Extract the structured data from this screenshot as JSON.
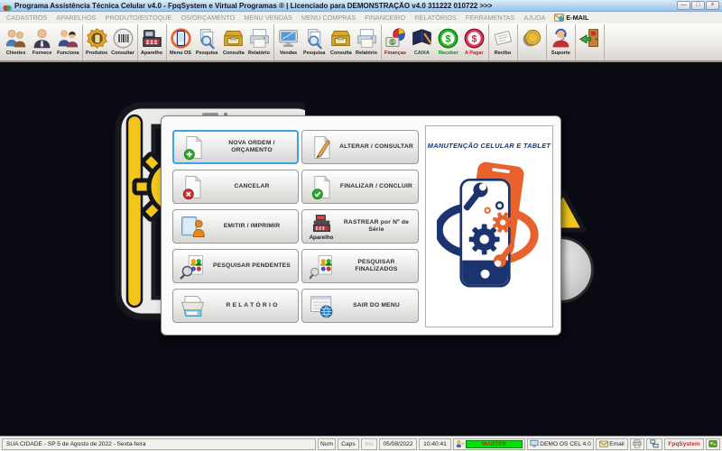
{
  "colors": {
    "accent_blue": "#3fa2e2",
    "brand_orange": "#e8622d",
    "brand_navy": "#1b3470",
    "master_green": "#00e106",
    "fpq_red": "#e02424"
  },
  "window": {
    "title": "Programa Assistência Técnica Celular v4.0 - FpqSystem e Virtual Programas ® | Licenciado para  DEMONSTRAÇÃO v4.0 311222 010722 >>>",
    "controls": {
      "minimize": "—",
      "maximize": "□",
      "close": "×"
    }
  },
  "menubar": {
    "items": [
      {
        "label": "CADASTROS"
      },
      {
        "label": "APARELHOS"
      },
      {
        "label": "PRODUTO/ESTOQUE"
      },
      {
        "label": "OS/ORÇAMENTO"
      },
      {
        "label": "MENU VENDAS"
      },
      {
        "label": "MENU COMPRAS"
      },
      {
        "label": "FINANCEIRO"
      },
      {
        "label": "RELATÓRIOS"
      },
      {
        "label": "FERRAMENTAS"
      },
      {
        "label": "AJUDA"
      },
      {
        "label": "E-MAIL",
        "icon": "email-icon"
      }
    ]
  },
  "toolbar": {
    "groups": [
      {
        "items": [
          {
            "label": "Clientes",
            "icon": "clients-icon"
          },
          {
            "label": "Fornece",
            "icon": "suppliers-icon"
          },
          {
            "label": "Funciona",
            "icon": "employees-icon"
          }
        ]
      },
      {
        "items": [
          {
            "label": "Produtos",
            "icon": "products-icon"
          },
          {
            "label": "Consultar",
            "icon": "barcode-icon"
          }
        ]
      },
      {
        "items": [
          {
            "label": "Aparelho",
            "icon": "device-icon"
          }
        ]
      },
      {
        "items": [
          {
            "label": "Menu OS",
            "icon": "service-order-icon"
          },
          {
            "label": "Pesquisa",
            "icon": "search-docs-icon"
          },
          {
            "label": "Consulta",
            "icon": "drawer-icon"
          },
          {
            "label": "Relatório",
            "icon": "printer-icon"
          }
        ]
      },
      {
        "items": [
          {
            "label": "Vendas",
            "icon": "sales-icon"
          },
          {
            "label": "Pesquisa",
            "icon": "search-docs-icon"
          },
          {
            "label": "Consulta",
            "icon": "drawer-icon"
          },
          {
            "label": "Relatório",
            "icon": "printer-icon"
          }
        ]
      },
      {
        "items": [
          {
            "label": "Finanças",
            "icon": "finance-icon",
            "color": "#7a1e14"
          },
          {
            "label": "CAIXA",
            "icon": "cashbook-icon",
            "color": "#1c5a20"
          },
          {
            "label": "Receber",
            "icon": "receive-icon",
            "color": "#0a8a0a"
          },
          {
            "label": "A Pagar",
            "icon": "pay-icon",
            "color": "#d01818"
          }
        ]
      },
      {
        "items": [
          {
            "label": "Recibo",
            "icon": "receipt-icon"
          }
        ]
      },
      {
        "items": [
          {
            "label": "",
            "icon": "coin-icon"
          }
        ]
      },
      {
        "items": [
          {
            "label": "Suporte",
            "icon": "support-icon"
          }
        ]
      },
      {
        "items": [
          {
            "label": "",
            "icon": "exit-door-icon"
          }
        ]
      }
    ]
  },
  "dialog": {
    "buttons": [
      {
        "label": "NOVA ORDEM / ORÇAMENTO",
        "icon": "doc-plus-icon",
        "selected": true
      },
      {
        "label": "ALTERAR  /  CONSULTAR",
        "icon": "doc-pencil-icon"
      },
      {
        "label": "CANCELAR",
        "icon": "doc-cancel-icon"
      },
      {
        "label": "FINALIZAR  /  CONCLUIR",
        "icon": "doc-check-icon"
      },
      {
        "label": "EMITIR  /  IMPRIMIR",
        "icon": "emit-person-icon"
      },
      {
        "label": "RASTREAR por Nº de Série",
        "icon": "register-icon",
        "sublabel": "Aparelho"
      },
      {
        "label": "PESQUISAR PENDENTES",
        "icon": "search-people-icon"
      },
      {
        "label": "PESQUISAR FINALIZADOS",
        "icon": "search-people2-icon"
      },
      {
        "label": "R E L A T Ó R I O",
        "icon": "report-printer-icon"
      },
      {
        "label": "SAIR DO MENU",
        "icon": "exit-menu-icon"
      }
    ],
    "logo_panel": {
      "title": "MANUTENÇÃO CELULAR E TABLET"
    }
  },
  "statusbar": {
    "location": "SUA CIDADE - SP  5 de Agosto de 2022 - Sexta-feira",
    "num": "Num",
    "caps": "Caps",
    "ins": "Ins",
    "date": "05/08/2022",
    "time": "10:40:41",
    "user": "MASTER",
    "system": "DEMO OS CEL 4.0",
    "email": "Email",
    "brand": "FpqSystem"
  }
}
